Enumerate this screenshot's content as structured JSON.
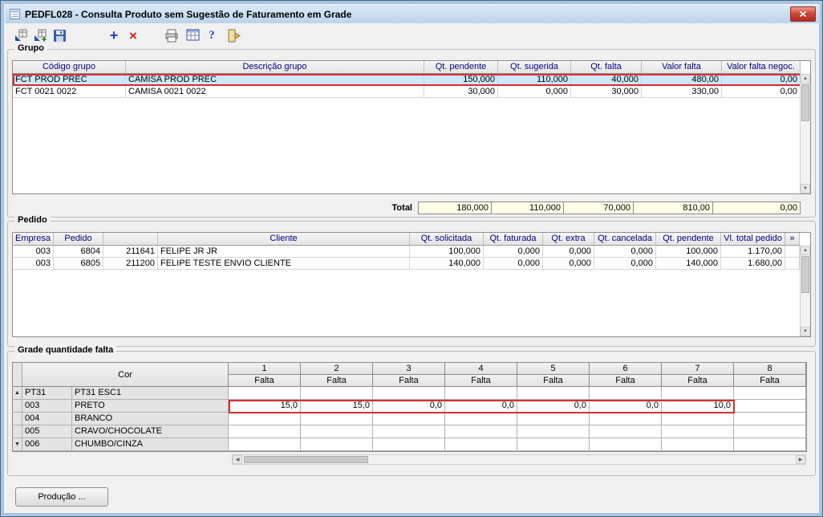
{
  "window": {
    "title": "PEDFL028 - Consulta Produto sem Sugestão de Faturamento em Grade"
  },
  "toolbar": {
    "icons": [
      "transfer-icon",
      "transfer-add-icon",
      "save-icon",
      "add-icon",
      "delete-icon",
      "print-icon",
      "grid-icon",
      "help-icon",
      "exit-icon"
    ],
    "add_glyph": "+",
    "delete_glyph": "×",
    "help_glyph": "?"
  },
  "grupo": {
    "label": "Grupo",
    "columns": [
      "Código grupo",
      "Descrição grupo",
      "Qt. pendente",
      "Qt. sugerida",
      "Qt. falta",
      "Valor falta",
      "Valor falta negoc."
    ],
    "rows": [
      [
        "FCT PROD PREC",
        "CAMISA PROD PREC",
        "150,000",
        "110,000",
        "40,000",
        "480,00",
        "0,00"
      ],
      [
        "FCT 0021 0022",
        "CAMISA 0021 0022",
        "30,000",
        "0,000",
        "30,000",
        "330,00",
        "0,00"
      ]
    ],
    "selected_row": 0,
    "total_label": "Total",
    "totals": [
      "180,000",
      "110,000",
      "70,000",
      "810,00",
      "0,00"
    ]
  },
  "pedido": {
    "label": "Pedido",
    "columns": [
      "Empresa",
      "Pedido",
      "",
      "Cliente",
      "Qt. solicitada",
      "Qt. faturada",
      "Qt. extra",
      "Qt. cancelada",
      "Qt. pendente",
      "Vl. total pedido",
      "»"
    ],
    "rows": [
      [
        "003",
        "6804",
        "211641",
        "FELIPE JR JR",
        "100,000",
        "0,000",
        "0,000",
        "0,000",
        "100,000",
        "1.170,00",
        ""
      ],
      [
        "003",
        "6805",
        "211200",
        "FELIPE TESTE ENVIO CLIENTE",
        "140,000",
        "0,000",
        "0,000",
        "0,000",
        "140,000",
        "1.680,00",
        ""
      ]
    ]
  },
  "grade": {
    "label": "Grade quantidade falta",
    "cor_header": "Cor",
    "size_columns": [
      "1",
      "2",
      "3",
      "4",
      "5",
      "6",
      "7",
      "8"
    ],
    "subheader": "Falta",
    "rows": [
      {
        "code": "PT31",
        "name": "PT31 ESC1",
        "values": [
          "",
          "",
          "",
          "",
          "",
          "",
          "",
          ""
        ]
      },
      {
        "code": "003",
        "name": "PRETO",
        "values": [
          "15,0",
          "15,0",
          "0,0",
          "0,0",
          "0,0",
          "0,0",
          "10,0",
          ""
        ]
      },
      {
        "code": "004",
        "name": "BRANCO",
        "values": [
          "",
          "",
          "",
          "",
          "",
          "",
          "",
          ""
        ]
      },
      {
        "code": "005",
        "name": "CRAVO/CHOCOLATE",
        "values": [
          "",
          "",
          "",
          "",
          "",
          "",
          "",
          ""
        ]
      },
      {
        "code": "006",
        "name": "CHUMBO/CINZA",
        "values": [
          "",
          "",
          "",
          "",
          "",
          "",
          "",
          ""
        ]
      }
    ],
    "highlight": {
      "row": 1,
      "col_start": 0,
      "col_end": 6
    }
  },
  "footer": {
    "producao_button": "Produção ..."
  }
}
